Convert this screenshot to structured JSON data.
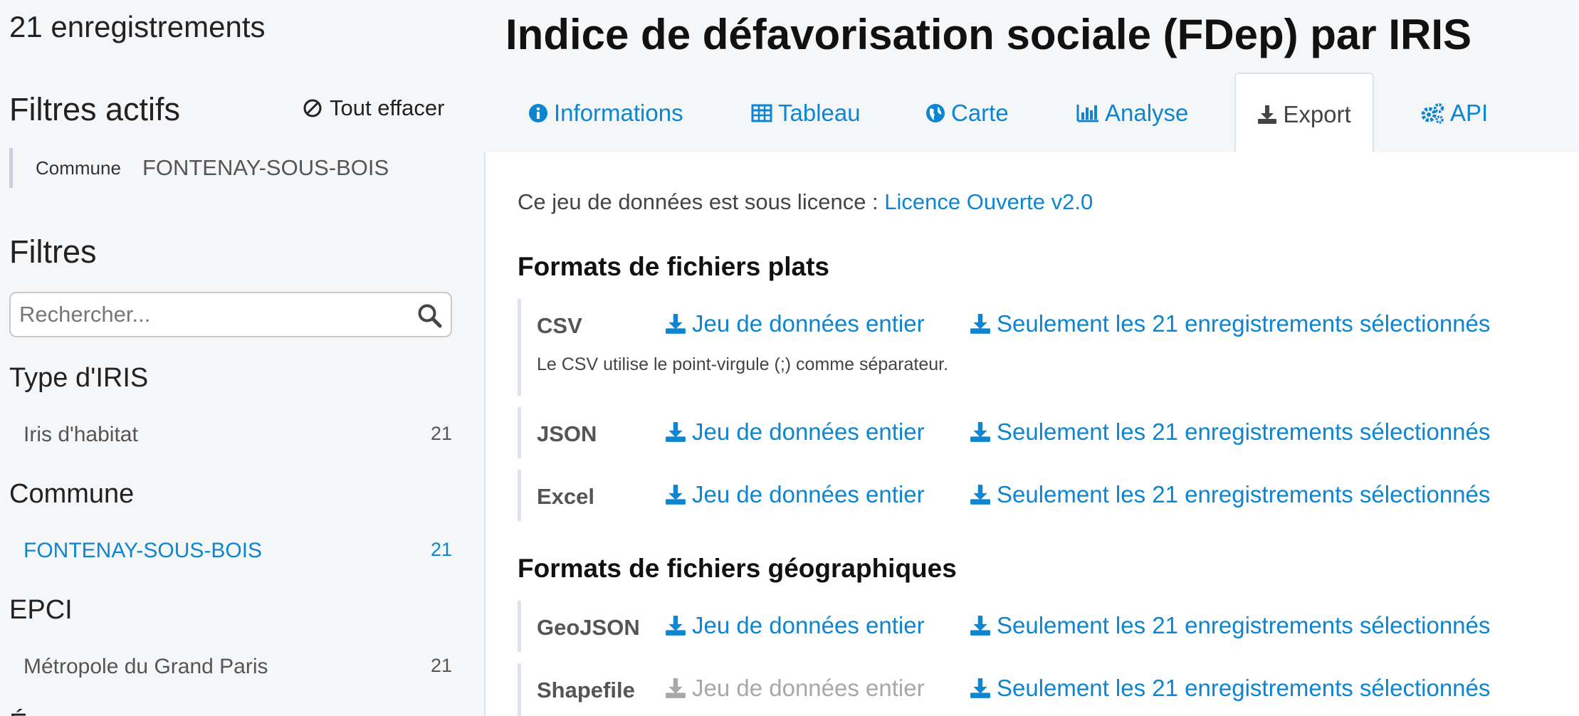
{
  "sidebar": {
    "record_count": "21 enregistrements",
    "active_filters_title": "Filtres actifs",
    "clear_all_label": "Tout effacer",
    "active_filter": {
      "label": "Commune",
      "value": "FONTENAY-SOUS-BOIS"
    },
    "filters_title": "Filtres",
    "search_placeholder": "Rechercher...",
    "facets": [
      {
        "title": "Type d'IRIS",
        "items": [
          {
            "label": "Iris d'habitat",
            "count": "21"
          }
        ]
      },
      {
        "title": "Commune",
        "items": [
          {
            "label": "FONTENAY-SOUS-BOIS",
            "count": "21"
          }
        ]
      },
      {
        "title": "EPCI",
        "items": [
          {
            "label": "Métropole du Grand Paris",
            "count": "21"
          }
        ]
      }
    ],
    "cut_text": "É"
  },
  "page_title": "Indice de défavorisation sociale (FDep) par IRIS",
  "tabs": [
    {
      "label": "Informations",
      "icon": "info-icon"
    },
    {
      "label": "Tableau",
      "icon": "table-icon"
    },
    {
      "label": "Carte",
      "icon": "globe-icon"
    },
    {
      "label": "Analyse",
      "icon": "bar-chart-icon"
    },
    {
      "label": "Export",
      "icon": "download-icon"
    },
    {
      "label": "API",
      "icon": "gears-icon"
    }
  ],
  "active_tab": "Export",
  "export": {
    "licence_text": "Ce jeu de données est sous licence :",
    "licence_link": "Licence Ouverte v2.0",
    "flat_title": "Formats de fichiers plats",
    "geo_title": "Formats de fichiers géographiques",
    "full_label": "Jeu de données entier",
    "selected_label": "Seulement les 21 enregistrements sélectionnés",
    "csv_note": "Le CSV utilise le point-virgule (;) comme séparateur.",
    "flat_formats": [
      "CSV",
      "JSON",
      "Excel"
    ],
    "geo_formats": [
      "GeoJSON",
      "Shapefile"
    ]
  },
  "colors": {
    "link": "#0e85d0",
    "disabled": "#a8a8a8",
    "border": "#dde3ec"
  }
}
